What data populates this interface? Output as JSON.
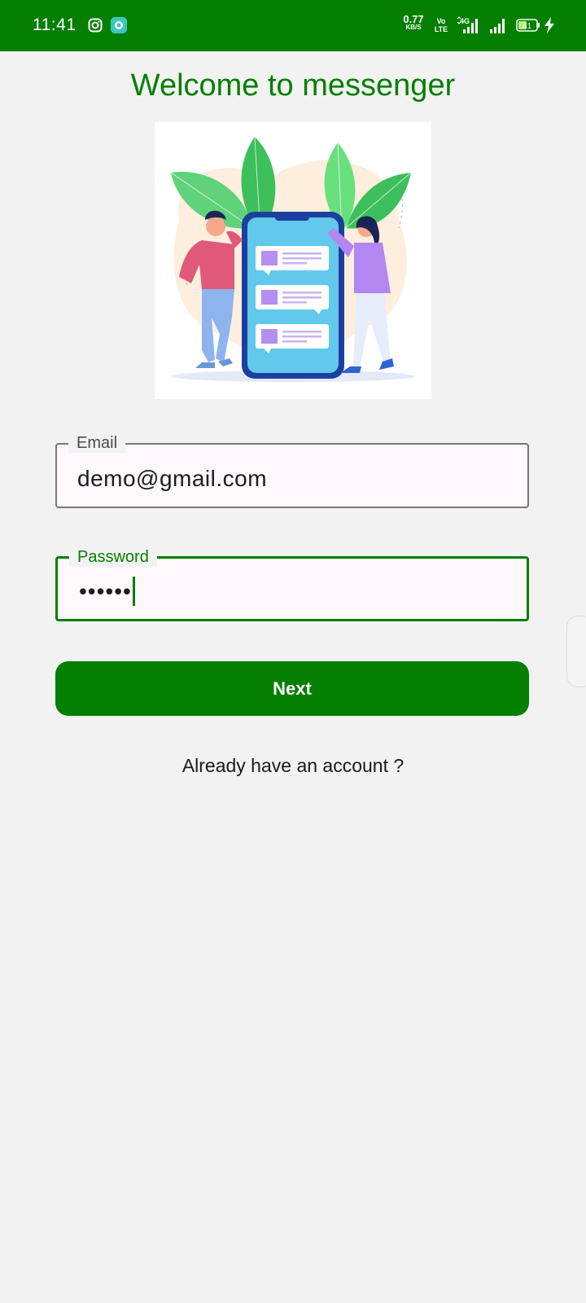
{
  "status_bar": {
    "time": "11:41",
    "net_speed_value": "0.77",
    "net_speed_unit": "KB/S",
    "volte_top": "Vo",
    "volte_bottom": "LTE",
    "network": "4G",
    "battery": "41",
    "icons": [
      "instagram-icon",
      "chat-app-icon",
      "signal-icon",
      "battery-icon",
      "charging-icon"
    ]
  },
  "title": "Welcome to messenger",
  "form": {
    "email_label": "Email",
    "email_value": "demo@gmail.com",
    "password_label": "Password",
    "password_value": "••••••"
  },
  "next_button": "Next",
  "login_link": "Already have an account ?",
  "colors": {
    "primary": "#047f00",
    "background": "#f2f2f2",
    "field_bg": "#fdf8fc"
  }
}
